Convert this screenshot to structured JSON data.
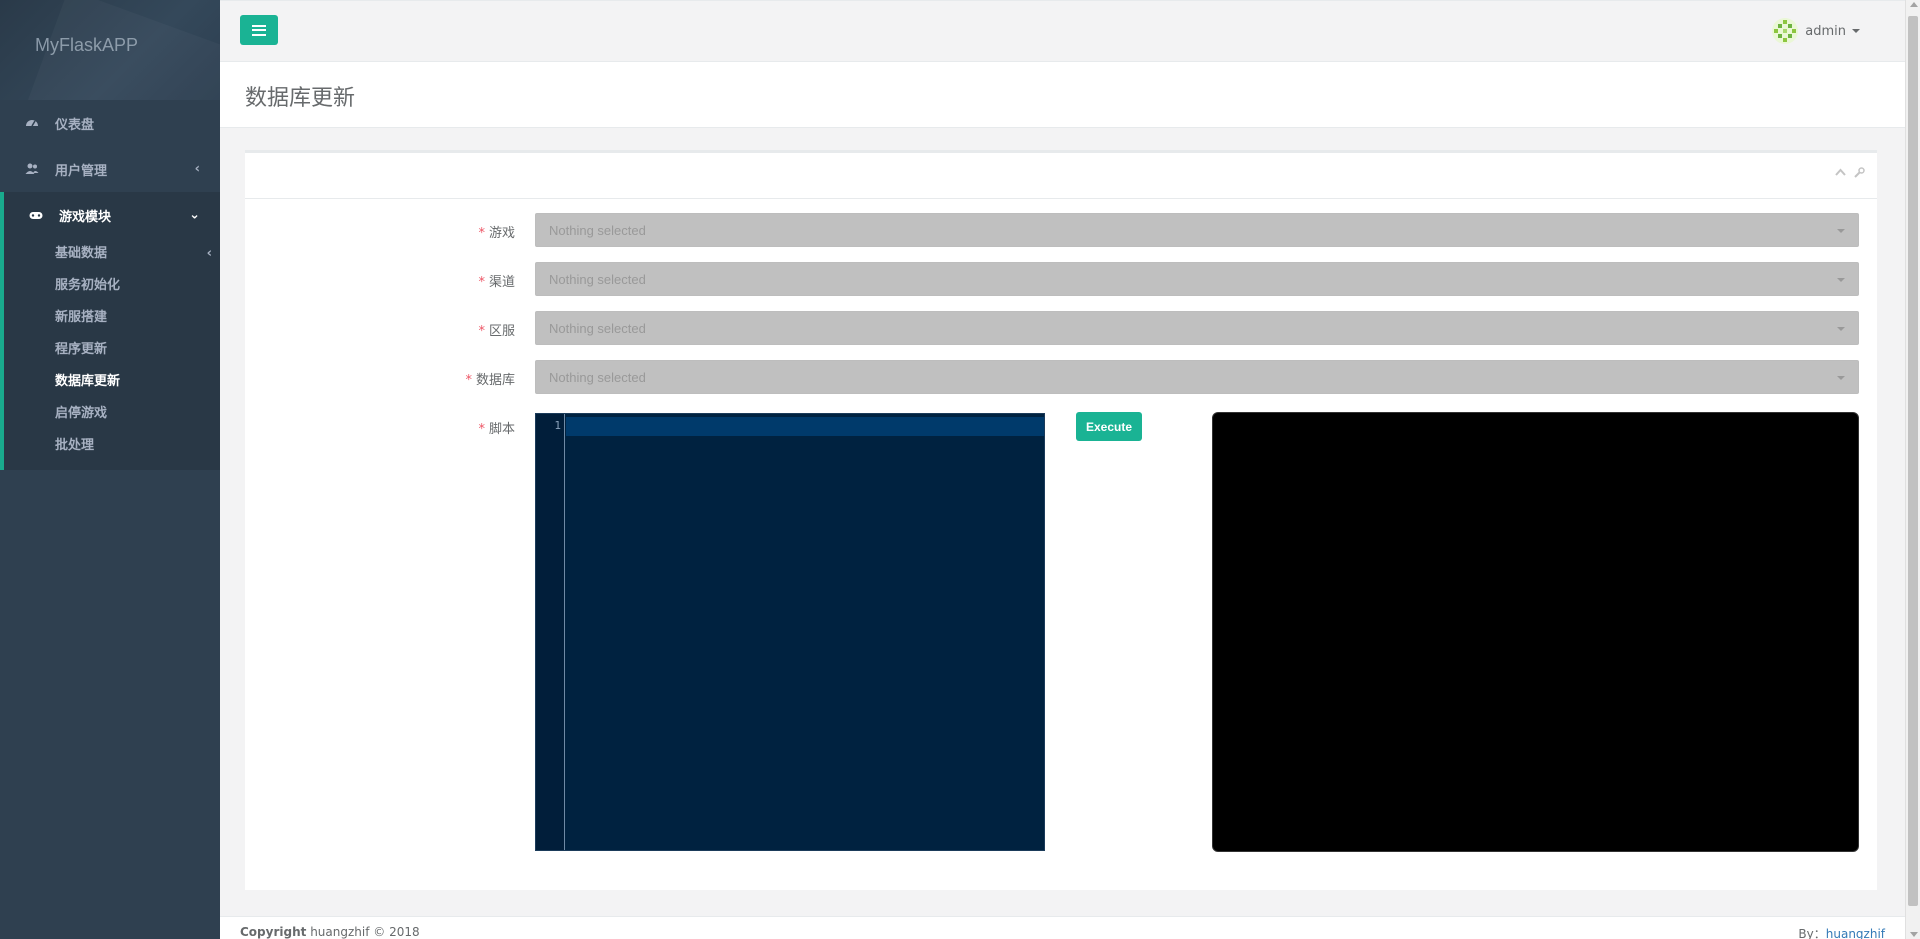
{
  "app": {
    "brand": "MyFlaskAPP"
  },
  "sidebar": {
    "items": [
      {
        "label": "仪表盘",
        "icon": "dashboard-icon"
      },
      {
        "label": "用户管理",
        "icon": "users-icon"
      },
      {
        "label": "游戏模块",
        "icon": "gamepad-icon"
      }
    ],
    "submenu": [
      {
        "label": "基础数据"
      },
      {
        "label": "服务初始化"
      },
      {
        "label": "新服搭建"
      },
      {
        "label": "程序更新"
      },
      {
        "label": "数据库更新"
      },
      {
        "label": "启停游戏"
      },
      {
        "label": "批处理"
      }
    ],
    "active_color": "#19aa8d"
  },
  "header": {
    "user": "admin"
  },
  "page": {
    "title": "数据库更新"
  },
  "form": {
    "fields": [
      {
        "label": "游戏",
        "placeholder": "Nothing selected"
      },
      {
        "label": "渠道",
        "placeholder": "Nothing selected"
      },
      {
        "label": "区服",
        "placeholder": "Nothing selected"
      },
      {
        "label": "数据库",
        "placeholder": "Nothing selected"
      }
    ],
    "script_label": "脚本",
    "editor": {
      "line_number": "1"
    },
    "execute_label": "Execute"
  },
  "footer": {
    "copyright_label": "Copyright",
    "copyright_text": "huangzhif © 2018",
    "by_label": "By：",
    "by_link": "huangzhif"
  },
  "colors": {
    "accent": "#1ab394",
    "sidebar": "#2f4050",
    "editor_bg": "#002240",
    "required": "#ed5565"
  }
}
